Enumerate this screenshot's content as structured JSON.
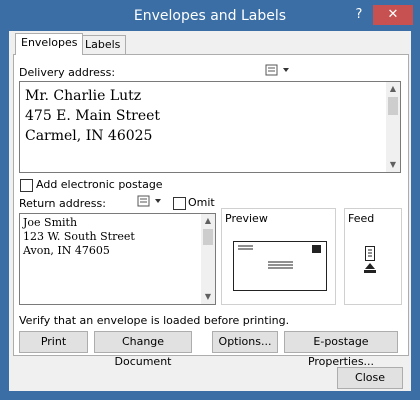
{
  "titlebar": {
    "title": "Envelopes and Labels",
    "help": "?",
    "close": "✕"
  },
  "tabs": [
    {
      "label": "Envelopes"
    },
    {
      "label": "Labels"
    }
  ],
  "delivery": {
    "label": "Delivery address:",
    "lines": [
      "Mr. Charlie Lutz",
      "475 E. Main Street",
      "Carmel, IN 46025"
    ]
  },
  "postage": {
    "label": "Add electronic postage",
    "checked": false
  },
  "return": {
    "label": "Return address:",
    "omit_label": "Omit",
    "omit_checked": false,
    "lines": [
      "Joe Smith",
      "123 W. South Street",
      "Avon, IN 47605"
    ]
  },
  "preview": {
    "label": "Preview"
  },
  "feed": {
    "label": "Feed"
  },
  "verify_text": "Verify that an envelope is loaded before printing.",
  "buttons": {
    "print": "Print",
    "change": "Change Document",
    "options": "Options...",
    "epostage": "E-postage Properties...",
    "close": "Close"
  },
  "icons": {
    "address_book": "address-book-icon",
    "dropdown": "▾"
  }
}
